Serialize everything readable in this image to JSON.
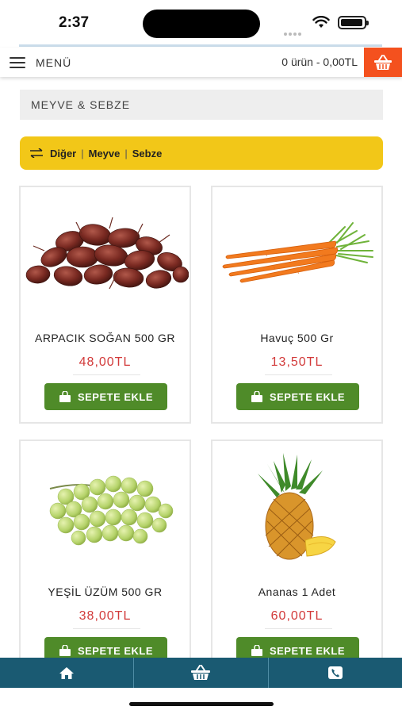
{
  "status_bar": {
    "time": "2:37"
  },
  "header": {
    "menu_label": "MENÜ",
    "cart_summary": "0 ürün - 0,00TL"
  },
  "category": {
    "title": "MEYVE & SEBZE"
  },
  "filters": [
    "Diğer",
    "Meyve",
    "Sebze"
  ],
  "products": [
    {
      "name": "ARPACIK SOĞAN 500 GR",
      "price": "48,00TL",
      "button": "SEPETE EKLE",
      "image": "shallots"
    },
    {
      "name": "Havuç 500 Gr",
      "price": "13,50TL",
      "button": "SEPETE EKLE",
      "image": "carrots"
    },
    {
      "name": "YEŞİL ÜZÜM 500 GR",
      "price": "38,00TL",
      "button": "SEPETE EKLE",
      "image": "green-grapes"
    },
    {
      "name": "Ananas 1 Adet",
      "price": "60,00TL",
      "button": "SEPETE EKLE",
      "image": "pineapple"
    }
  ],
  "colors": {
    "accent_orange": "#f4511e",
    "filter_yellow": "#f2c718",
    "button_green": "#4f8b29",
    "price_red": "#d23a3a",
    "nav_teal": "#1a5a72"
  },
  "bottom_nav": [
    "home-icon",
    "basket-icon",
    "phone-icon"
  ]
}
